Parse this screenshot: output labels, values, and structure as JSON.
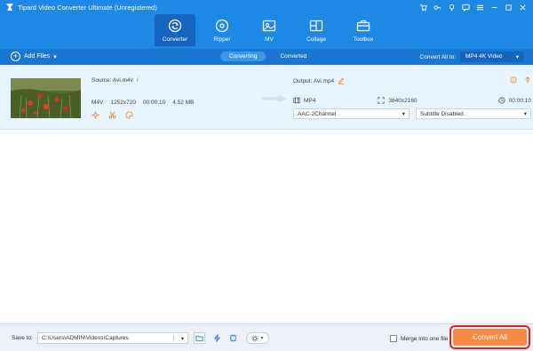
{
  "app": {
    "title": "Tipard Video Converter Ultimate (Unregistered)"
  },
  "window_controls": [
    "cart-icon",
    "key-icon",
    "bulb-icon",
    "chat-icon",
    "menu-icon",
    "minimize-icon",
    "maximize-icon",
    "close-icon"
  ],
  "main_tabs": [
    {
      "label": "Converter",
      "icon": "converter-icon",
      "active": true
    },
    {
      "label": "Ripper",
      "icon": "ripper-icon",
      "active": false
    },
    {
      "label": "MV",
      "icon": "mv-icon",
      "active": false
    },
    {
      "label": "Collage",
      "icon": "collage-icon",
      "active": false
    },
    {
      "label": "Toolbox",
      "icon": "toolbox-icon",
      "active": false
    }
  ],
  "toolbar": {
    "add_files": "Add Files",
    "sub_tabs": [
      {
        "label": "Converting",
        "active": true
      },
      {
        "label": "Converted",
        "active": false
      }
    ],
    "convert_all_to": "Convert All to:",
    "format": "MP4 4K Video"
  },
  "file": {
    "source": "Source: Avi.m4v",
    "format": "M4V",
    "resolution": "1252x720",
    "duration": "00:00:10",
    "size": "4.52 MB",
    "output": "Output: Avi.mp4",
    "out_format": "MP4",
    "out_resolution": "3840x2160",
    "out_duration": "00:00:10",
    "audio": "AAC-2Channel",
    "subtitle": "Subtitle Disabled"
  },
  "bottom": {
    "save_to": "Save to:",
    "path": "C:\\Users\\ADMIN\\Videos\\Captures",
    "merge": "Merge into one file",
    "convert_all": "Convert All"
  },
  "colors": {
    "header": "#1e88e5",
    "accent": "#f58a45",
    "highlight": "#e02020"
  }
}
